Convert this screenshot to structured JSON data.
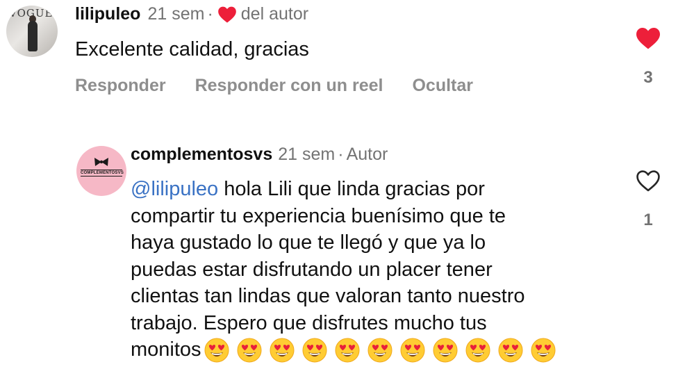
{
  "comment1": {
    "username": "lilipuleo",
    "time": "21 sem",
    "separator": "·",
    "author_like_label": "del autor",
    "text": "Excelente calidad, gracias",
    "actions": {
      "reply": "Responder",
      "reply_reel": "Responder con un reel",
      "hide": "Ocultar"
    },
    "like_count": "3",
    "liked": true
  },
  "comment2": {
    "username": "complementosvs",
    "time": "21 sem",
    "separator": "·",
    "role": "Autor",
    "avatar_logo_text": "COMPLEMENTOSVS",
    "mention": "@lilipuleo",
    "lines": [
      " hola Lili que linda gracias por",
      "compartir tu experiencia buenísimo que te",
      "haya gustado lo que te llegó y que ya lo",
      "puedas estar disfrutando un placer tener",
      "clientas tan lindas que valoran tanto nuestro",
      "trabajo. Espero que disfrutes mucho tus",
      "monitos"
    ],
    "emoji_count": 11,
    "emoji_name": "heart-eyes-emoji",
    "like_count": "1",
    "liked": false
  },
  "colors": {
    "like_red": "#ed1f3a",
    "meta_gray": "#737373",
    "action_gray": "#8e8e8e",
    "mention_blue": "#3a72c4",
    "avatar2_pink": "#f6b8c6"
  }
}
